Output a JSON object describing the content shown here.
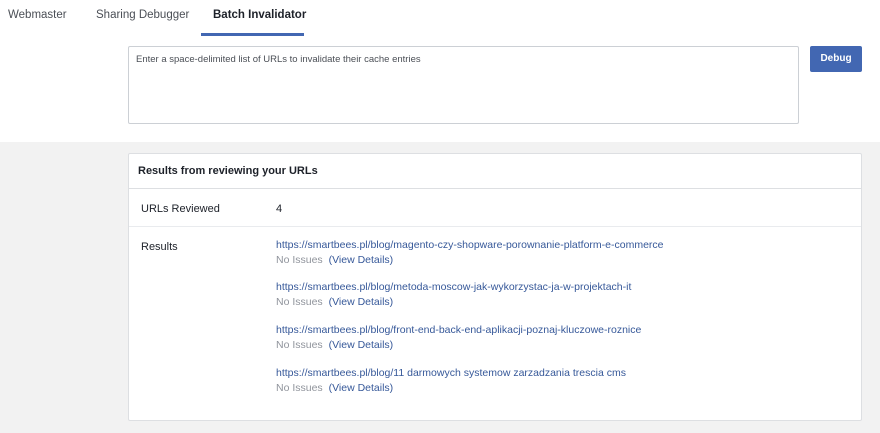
{
  "tabs": [
    {
      "label": "Webmaster"
    },
    {
      "label": "Sharing Debugger"
    },
    {
      "label": "Batch Invalidator",
      "active": true
    }
  ],
  "input": {
    "placeholder": "Enter a space-delimited list of URLs to invalidate their cache entries",
    "value": ""
  },
  "debug_button": {
    "label": "Debug"
  },
  "results_card": {
    "title": "Results from reviewing your URLs",
    "reviewed_label": "URLs Reviewed",
    "reviewed_count": "4",
    "results_label": "Results",
    "results": [
      {
        "url": "https://smartbees.pl/blog/magento-czy-shopware-porownanie-platform-e-commerce",
        "status": "No Issues",
        "details": "(View Details)"
      },
      {
        "url": "https://smartbees.pl/blog/metoda-moscow-jak-wykorzystac-ja-w-projektach-it",
        "status": "No Issues",
        "details": "(View Details)"
      },
      {
        "url": "https://smartbees.pl/blog/front-end-back-end-aplikacji-poznaj-kluczowe-roznice",
        "status": "No Issues",
        "details": "(View Details)"
      },
      {
        "url": "https://smartbees.pl/blog/11 darmowych systemow zarzadzania trescia cms",
        "status": "No Issues",
        "details": "(View Details)"
      }
    ]
  },
  "colors": {
    "accent": "#4267b2",
    "link": "#365899",
    "muted_text": "#90949c",
    "page_background": "#f2f2f2"
  }
}
